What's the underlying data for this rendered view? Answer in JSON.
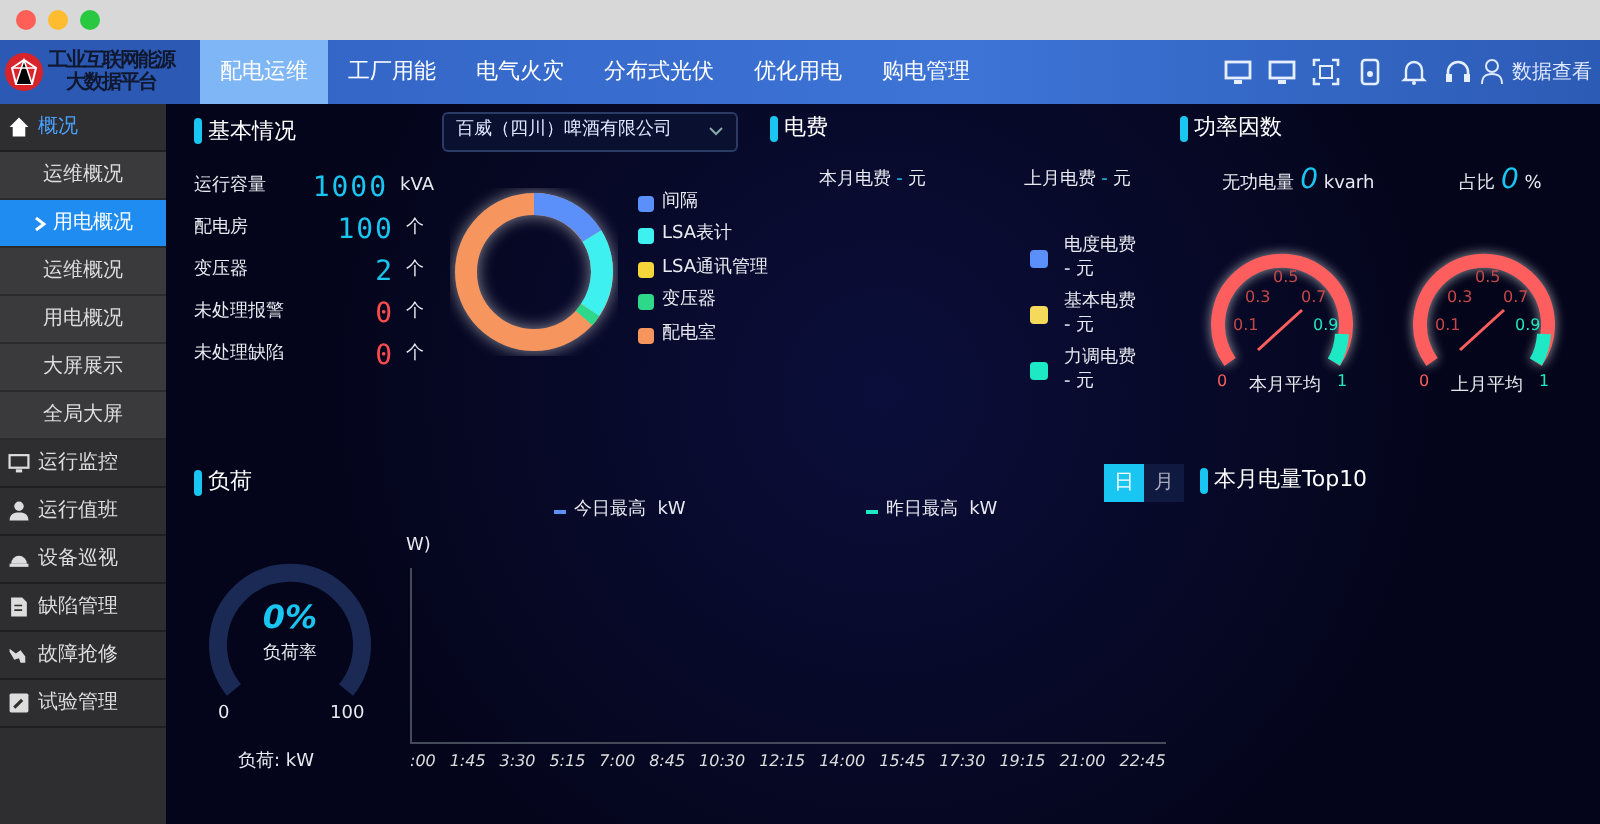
{
  "brand": {
    "title_lines": [
      "工业互联网能源",
      "大数据平台"
    ]
  },
  "nav": [
    {
      "label": "配电运维",
      "selected": true
    },
    {
      "label": "工厂用能",
      "selected": false
    },
    {
      "label": "电气火灾",
      "selected": false
    },
    {
      "label": "分布式光伏",
      "selected": false
    },
    {
      "label": "优化用电",
      "selected": false
    },
    {
      "label": "购电管理",
      "selected": false
    }
  ],
  "user": {
    "label": "数据查看"
  },
  "sidebar": [
    {
      "label": "概况",
      "expanded": true,
      "children": [
        {
          "label": "运维概况",
          "selected": false
        },
        {
          "label": "用电概况",
          "selected": true
        },
        {
          "label": "运维概况",
          "selected": false
        },
        {
          "label": "用电概况",
          "selected": false
        },
        {
          "label": "大屏展示",
          "selected": false
        },
        {
          "label": "全局大屏",
          "selected": false
        }
      ]
    },
    {
      "label": "运行监控",
      "expanded": false
    },
    {
      "label": "运行值班",
      "expanded": false
    },
    {
      "label": "设备巡视",
      "expanded": false
    },
    {
      "label": "缺陷管理",
      "expanded": false
    },
    {
      "label": "故障抢修",
      "expanded": false
    },
    {
      "label": "试验管理",
      "expanded": false
    }
  ],
  "basic": {
    "title": "基本情况",
    "company": "百威（四川）啤酒有限公司",
    "stats": [
      {
        "label": "运行容量",
        "value": "1000",
        "unit": "kVA",
        "alert": false
      },
      {
        "label": "配电房",
        "value": "100",
        "unit": "个",
        "alert": false
      },
      {
        "label": "变压器",
        "value": "2",
        "unit": "个",
        "alert": false
      },
      {
        "label": "未处理报警",
        "value": "0",
        "unit": "个",
        "alert": true
      },
      {
        "label": "未处理缺陷",
        "value": "0",
        "unit": "个",
        "alert": true
      }
    ],
    "legend": [
      {
        "label": "间隔",
        "color": "#5b8ff9"
      },
      {
        "label": "LSA表计",
        "color": "#3ff0f0"
      },
      {
        "label": "LSA通讯管理",
        "color": "#f5d53a"
      },
      {
        "label": "变压器",
        "color": "#2ed88a"
      },
      {
        "label": "配电室",
        "color": "#f6965e"
      }
    ]
  },
  "fee": {
    "title": "电费",
    "summary": [
      {
        "label": "本月电费",
        "value": "-",
        "unit": "元"
      },
      {
        "label": "上月电费",
        "value": "-",
        "unit": "元"
      }
    ],
    "legend": [
      {
        "label": "电度电费",
        "value": "- 元",
        "color": "#5b8ff9"
      },
      {
        "label": "基本电费",
        "value": "- 元",
        "color": "#f5d95a"
      },
      {
        "label": "力调电费",
        "value": "- 元",
        "color": "#1de9c4"
      }
    ]
  },
  "power_factor": {
    "title": "功率因数",
    "readings": [
      {
        "label": "无功电量",
        "value": "0",
        "unit": "kvarh"
      },
      {
        "label": "占比",
        "value": "0",
        "unit": "%"
      }
    ],
    "gauges": [
      {
        "caption": "本月平均",
        "ticks": [
          "0",
          "0.1",
          "0.3",
          "0.5",
          "0.7",
          "0.9",
          "1"
        ]
      },
      {
        "caption": "上月平均",
        "ticks": [
          "0",
          "0.1",
          "0.3",
          "0.5",
          "0.7",
          "0.9",
          "1"
        ]
      }
    ]
  },
  "load": {
    "title": "负荷",
    "toggle": [
      {
        "label": "日",
        "selected": true
      },
      {
        "label": "月",
        "selected": false
      }
    ],
    "rate": {
      "value": "0%",
      "label": "负荷率",
      "min": "0",
      "max": "100",
      "footer": "负荷: kW"
    },
    "series": [
      {
        "name": "今日最高  kW",
        "color": "#5b8ff9"
      },
      {
        "name": "昨日最高  kW",
        "color": "#1de9c4"
      }
    ],
    "y_unit": "W)",
    "x_ticks": [
      ":00",
      "1:45",
      "3:30",
      "5:15",
      "7:00",
      "8:45",
      "10:30",
      "12:15",
      "14:00",
      "15:45",
      "17:30",
      "19:15",
      "21:00",
      "22:45"
    ]
  },
  "top10": {
    "title": "本月电量Top10"
  }
}
